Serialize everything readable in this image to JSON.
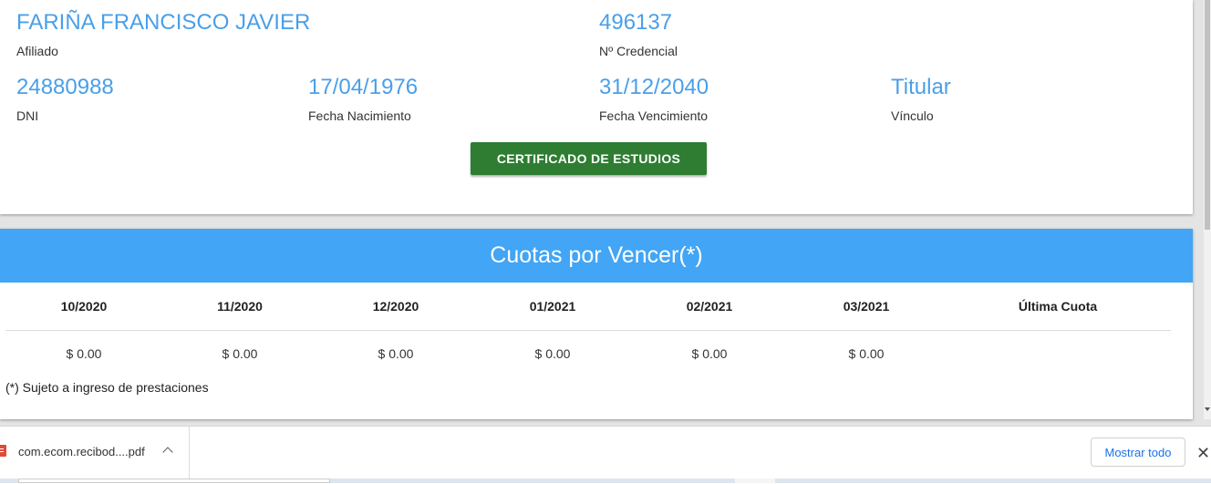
{
  "affiliate": {
    "name": "FARIÑA FRANCISCO JAVIER",
    "name_label": "Afiliado",
    "credential": "496137",
    "credential_label": "Nº Credencial",
    "dni": "24880988",
    "dni_label": "DNI",
    "birth_date": "17/04/1976",
    "birth_date_label": "Fecha Nacimiento",
    "expiry_date": "31/12/2040",
    "expiry_date_label": "Fecha Vencimiento",
    "relationship": "Titular",
    "relationship_label": "Vínculo",
    "certificate_button": "CERTIFICADO DE ESTUDIOS"
  },
  "fees": {
    "title": "Cuotas por Vencer(*)",
    "columns": [
      "10/2020",
      "11/2020",
      "12/2020",
      "01/2021",
      "02/2021",
      "03/2021",
      "Última Cuota"
    ],
    "values": [
      "$ 0.00",
      "$ 0.00",
      "$ 0.00",
      "$ 0.00",
      "$ 0.00",
      "$ 0.00",
      ""
    ],
    "footnote": "(*) Sujeto a ingreso de prestaciones"
  },
  "download_bar": {
    "file_name": "com.ecom.recibod....pdf",
    "file_icon": "pdf-file-icon",
    "show_all": "Mostrar todo",
    "close": "✕"
  },
  "colors": {
    "accent_blue": "#42a5f5",
    "value_blue": "#4a9fe8",
    "button_green": "#2e7d32"
  }
}
